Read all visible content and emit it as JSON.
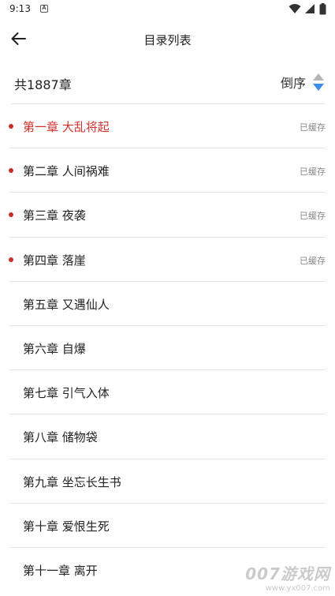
{
  "status_bar": {
    "time": "9:13",
    "notification_letter": "A"
  },
  "toolbar": {
    "title": "目录列表"
  },
  "summary": {
    "chapter_count": "共1887章",
    "sort_label": "倒序"
  },
  "colors": {
    "accent_red": "#d4302b",
    "sort_icon_up": "#b5b5b5",
    "sort_icon_down": "#3d8ee8"
  },
  "chapters": [
    {
      "title": "第一章 大乱将起",
      "cached": "已缓存"
    },
    {
      "title": "第二章 人间祸难",
      "cached": "已缓存"
    },
    {
      "title": "第三章 夜袭",
      "cached": "已缓存"
    },
    {
      "title": "第四章 落崖",
      "cached": "已缓存"
    },
    {
      "title": "第五章 又遇仙人",
      "cached": ""
    },
    {
      "title": "第六章 自爆",
      "cached": ""
    },
    {
      "title": "第七章 引气入体",
      "cached": ""
    },
    {
      "title": "第八章 储物袋",
      "cached": ""
    },
    {
      "title": "第九章 坐忘长生书",
      "cached": ""
    },
    {
      "title": "第十章 爱恨生死",
      "cached": ""
    },
    {
      "title": "第十一章 离开",
      "cached": ""
    }
  ],
  "watermark": {
    "logo": "007游戏网",
    "url": "www.yx007.com"
  }
}
